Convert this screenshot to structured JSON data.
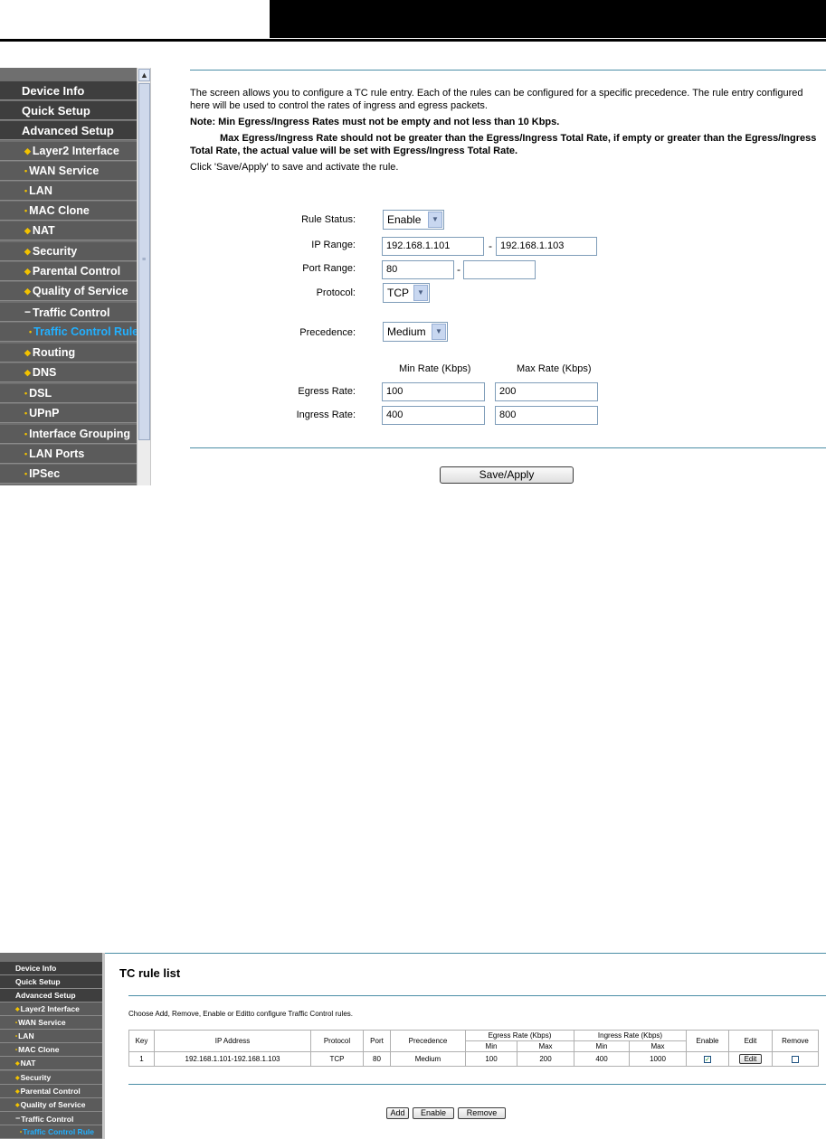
{
  "shot1": {
    "sidebar": {
      "top_items": [
        "Device Info",
        "Quick Setup",
        "Advanced Setup"
      ],
      "sub_items": [
        "Layer2 Interface",
        "WAN Service",
        "LAN",
        "MAC Clone",
        "NAT",
        "Security",
        "Parental Control",
        "Quality of Service",
        "Traffic Control"
      ],
      "active_sub": "Traffic Control Rule",
      "after_items": [
        "Routing",
        "DNS",
        "DSL",
        "UPnP",
        "Interface Grouping",
        "LAN Ports",
        "IPSec"
      ]
    },
    "intro": {
      "line1": "The screen allows you to configure a TC rule entry. Each of the rules can be configured for a specific precedence. The rule entry configured",
      "line2": "here will be used to control the rates of ingress and egress packets.",
      "note1": "Note: Min Egress/Ingress Rates must not be empty and not less than 10 Kbps.",
      "note2": "Max Egress/Ingress Rate should not be greater than the Egress/Ingress Total Rate, if empty or greater than the Egress/Ingress",
      "note3": "Total Rate, the actual value will be set with Egress/Ingress Total Rate.",
      "click": "Click 'Save/Apply' to save and activate the rule."
    },
    "form": {
      "rule_status_label": "Rule Status:",
      "rule_status_value": "Enable",
      "ip_range_label": "IP Range:",
      "ip_start": "192.168.1.101",
      "ip_end": "192.168.1.103",
      "port_range_label": "Port Range:",
      "port_start": "80",
      "port_end": "",
      "protocol_label": "Protocol:",
      "protocol_value": "TCP",
      "precedence_label": "Precedence:",
      "precedence_value": "Medium",
      "min_rate_header": "Min Rate (Kbps)",
      "max_rate_header": "Max Rate (Kbps)",
      "egress_label": "Egress Rate:",
      "egress_min": "100",
      "egress_max": "200",
      "ingress_label": "Ingress Rate:",
      "ingress_min": "400",
      "ingress_max": "800",
      "dash": "-",
      "save_label": "Save/Apply"
    }
  },
  "shot2": {
    "sidebar": {
      "top_items": [
        "Device Info",
        "Quick Setup",
        "Advanced Setup"
      ],
      "sub_items": [
        "Layer2 Interface",
        "WAN Service",
        "LAN",
        "MAC Clone",
        "NAT",
        "Security",
        "Parental Control",
        "Quality of Service",
        "Traffic Control"
      ],
      "active_sub": "Traffic Control Rule"
    },
    "title": "TC rule list",
    "instructions": "Choose Add, Remove, Enable or Editto configure Traffic Control rules.",
    "table": {
      "headers": {
        "key": "Key",
        "ip": "IP Address",
        "protocol": "Protocol",
        "port": "Port",
        "precedence": "Precedence",
        "egress": "Egress Rate (Kbps)",
        "ingress": "Ingress Rate (Kbps)",
        "enable": "Enable",
        "edit": "Edit",
        "remove": "Remove",
        "min": "Min",
        "max": "Max"
      },
      "row": {
        "key": "1",
        "ip": "192.168.1.101-192.168.1.103",
        "protocol": "TCP",
        "port": "80",
        "precedence": "Medium",
        "eg_min": "100",
        "eg_max": "200",
        "in_min": "400",
        "in_max": "1000",
        "edit_label": "Edit",
        "enable_checked": true,
        "remove_checked": false
      }
    },
    "buttons": {
      "add": "Add",
      "enable": "Enable",
      "remove": "Remove"
    }
  }
}
